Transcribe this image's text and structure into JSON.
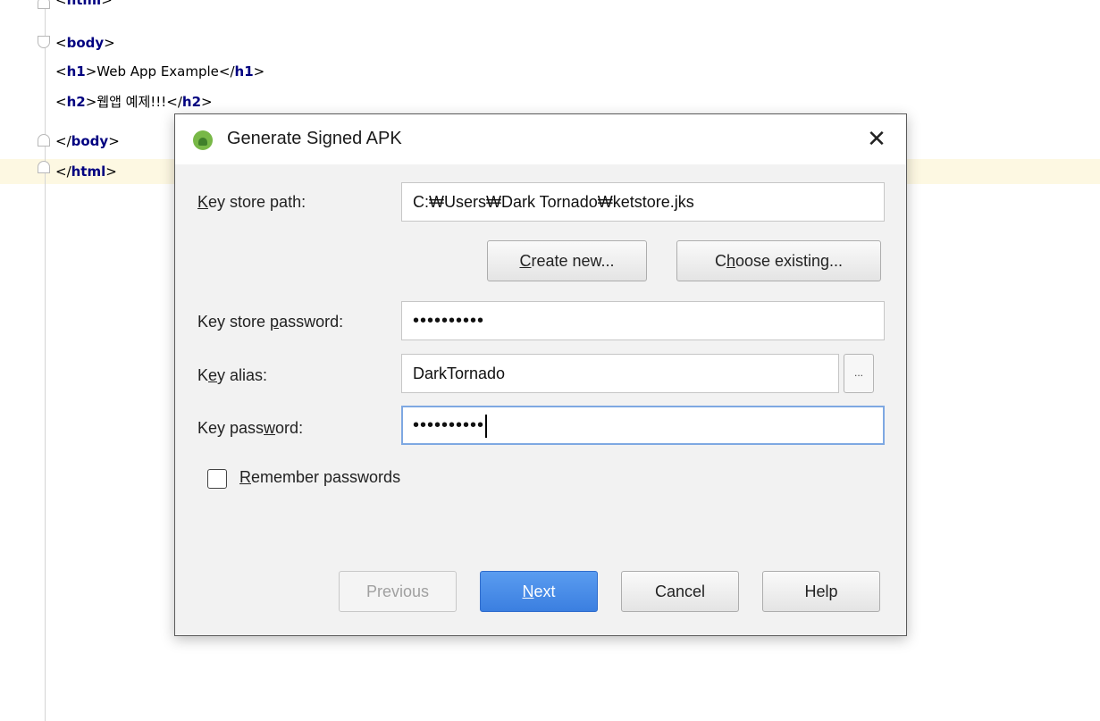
{
  "editor": {
    "lines": [
      {
        "pre": "<",
        "tag": "html",
        "post": ">"
      },
      {
        "pre": "<",
        "tag": "body",
        "post": ">"
      },
      {
        "pre": "<",
        "tag": "h1",
        "mid": ">Web App Example</",
        "tag2": "h1",
        "post": ">"
      },
      {
        "pre": "<",
        "tag": "h2",
        "mid": ">웹앱 예제!!!</",
        "tag2": "h2",
        "post": ">"
      },
      {
        "pre": "</",
        "tag": "body",
        "post": ">"
      },
      {
        "pre": "</",
        "tag": "html",
        "post": ">"
      }
    ]
  },
  "dialog": {
    "title": "Generate Signed APK",
    "close_glyph": "✕",
    "key_store_path": {
      "label_accel": "K",
      "label_rest": "ey store path:",
      "value": "C:₩Users₩Dark Tornado₩ketstore.jks"
    },
    "create_new": {
      "accel": "C",
      "rest": "reate new..."
    },
    "choose_existing": {
      "pre": "C",
      "accel": "h",
      "rest": "oose existing..."
    },
    "key_store_password": {
      "label_pre": "Key store ",
      "label_accel": "p",
      "label_rest": "assword:",
      "value": "••••••••••"
    },
    "key_alias": {
      "label_pre": "K",
      "label_accel": "e",
      "label_rest": "y alias:",
      "value": "DarkTornado",
      "browse_glyph": "..."
    },
    "key_password": {
      "label_pre": "Key pass",
      "label_accel": "w",
      "label_rest": "ord:",
      "value": "••••••••••"
    },
    "remember": {
      "accel": "R",
      "rest": "emember passwords",
      "checked": false
    },
    "buttons": {
      "previous": "Previous",
      "next_accel": "N",
      "next_rest": "ext",
      "cancel": "Cancel",
      "help": "Help"
    }
  }
}
